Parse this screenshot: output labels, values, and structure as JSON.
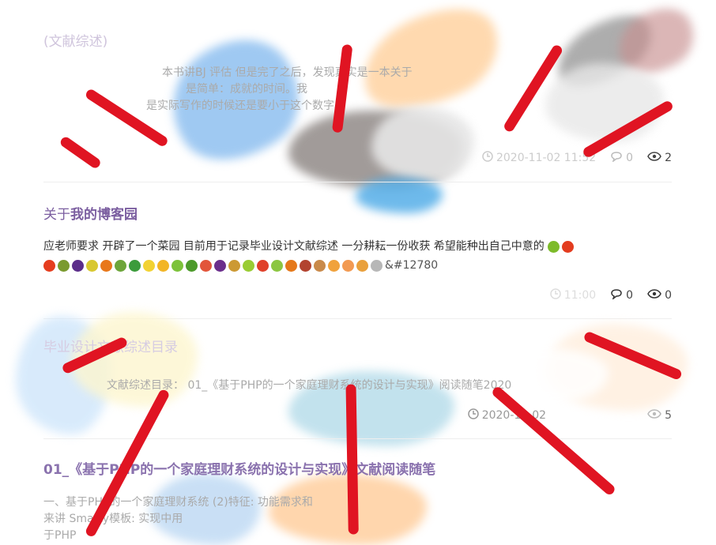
{
  "posts": [
    {
      "title": "(文献综述)",
      "excerpt_line1": "本书讲BJ 评估 但是完了之后，发现真实是一本关于",
      "excerpt_line2": "是简单：成就的时间。我",
      "excerpt_line3": "是实际写作的时候还是要小于这个数字。",
      "date": "2020-11-02 11:52",
      "comments": "0",
      "views": "2"
    },
    {
      "title_prefix": "关于",
      "title_rest": "我的博客园",
      "excerpt": "应老师要求 开辟了一个菜园 目前用于记录毕业设计文献综述 一分耕耘一份收获  希望能种出自己中意的",
      "entity": "&#12780",
      "date": "11:00",
      "comments": "0",
      "views": "0"
    },
    {
      "title": "毕业设计文献综述目录",
      "excerpt": "文献综述目录：  01_《基于PHP的一个家庭理财系统的设计与实现》阅读随笔2020",
      "date": "2020-11-02",
      "views": "5"
    },
    {
      "title": "01_《基于PHP的一个家庭理财系统的设计与实现》文献阅读随笔",
      "excerpt_line1": "一、基于PHP的一个家庭理财系统 (2)特征: 功能需求和",
      "excerpt_line2": "来讲 Smarty模板: 实现中用",
      "excerpt_line3": "于PHP"
    }
  ],
  "colors": {
    "title": "#7b5ea0",
    "stroke": "#e01422"
  },
  "icons": [
    "clock-icon",
    "comment-icon",
    "eye-icon",
    "fruit-emoji"
  ]
}
